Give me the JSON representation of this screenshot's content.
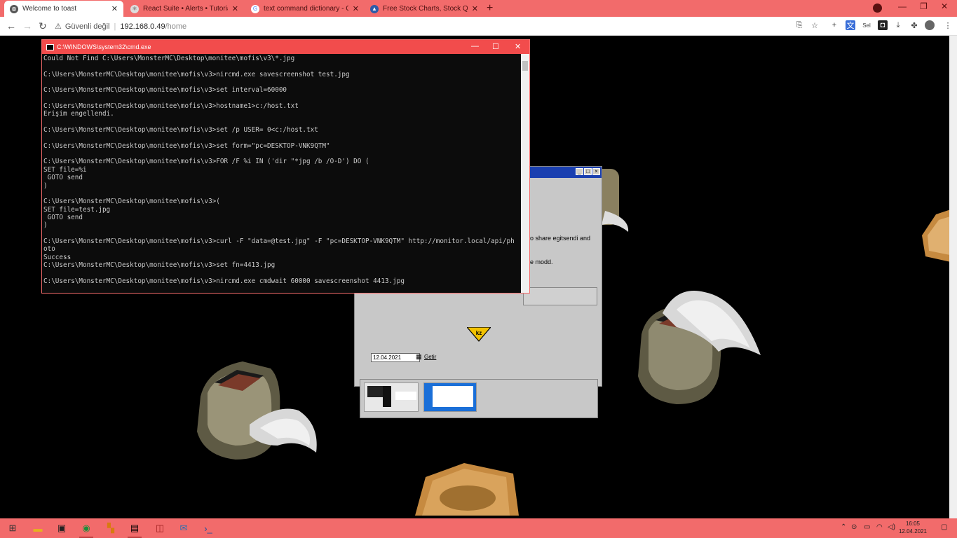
{
  "browser": {
    "tabs": [
      {
        "title": "Welcome to toast",
        "active": true,
        "icon": "globe-icon"
      },
      {
        "title": "React Suite • Alerts • Tutorialsp",
        "active": false,
        "icon": "react-icon"
      },
      {
        "title": "text command dictionary - Goo",
        "active": false,
        "icon": "google-icon"
      },
      {
        "title": "Free Stock Charts, Stock Quotes",
        "active": false,
        "icon": "chart-icon"
      }
    ],
    "address": {
      "security": "Güvenli değil",
      "host": "192.168.0.49",
      "path": "/home"
    }
  },
  "cmd": {
    "title": "C:\\WINDOWS\\system32\\cmd.exe",
    "lines": [
      "Could Not Find C:\\Users\\MonsterMC\\Desktop\\monitee\\mofis\\v3\\*.jpg",
      "",
      "C:\\Users\\MonsterMC\\Desktop\\monitee\\mofis\\v3>nircmd.exe savescreenshot test.jpg",
      "",
      "C:\\Users\\MonsterMC\\Desktop\\monitee\\mofis\\v3>set interval=60000",
      "",
      "C:\\Users\\MonsterMC\\Desktop\\monitee\\mofis\\v3>hostname1>c:/host.txt",
      "Erişim engellendi.",
      "",
      "C:\\Users\\MonsterMC\\Desktop\\monitee\\mofis\\v3>set /p USER= 0<c:/host.txt",
      "",
      "C:\\Users\\MonsterMC\\Desktop\\monitee\\mofis\\v3>set form=\"pc=DESKTOP-VNK9QTM\"",
      "",
      "C:\\Users\\MonsterMC\\Desktop\\monitee\\mofis\\v3>FOR /F %i IN ('dir \"*jpg /b /O-D') DO (",
      "SET file=%i",
      " GOTO send",
      ")",
      "",
      "C:\\Users\\MonsterMC\\Desktop\\monitee\\mofis\\v3>(",
      "SET file=test.jpg",
      " GOTO send",
      ")",
      "",
      "C:\\Users\\MonsterMC\\Desktop\\monitee\\mofis\\v3>curl -F \"data=@test.jpg\" -F \"pc=DESKTOP-VNK9QTM\" http://monitor.local/api/ph",
      "oto",
      "Success",
      "C:\\Users\\MonsterMC\\Desktop\\monitee\\mofis\\v3>set fn=4413.jpg",
      "",
      "C:\\Users\\MonsterMC\\Desktop\\monitee\\mofis\\v3>nircmd.exe cmdwait 60000 savescreenshot 4413.jpg"
    ]
  },
  "dialog": {
    "text1": "o share egitsendi and",
    "text2": "e modd.",
    "date_value": "12.04.2021",
    "date_button": "Getir"
  },
  "taskbar": {
    "clock_time": "16:05",
    "clock_date": "12.04.2021"
  },
  "colors": {
    "accent": "#f26b6b",
    "cmd_title": "#f24c4c",
    "page_bg": "#000000"
  }
}
